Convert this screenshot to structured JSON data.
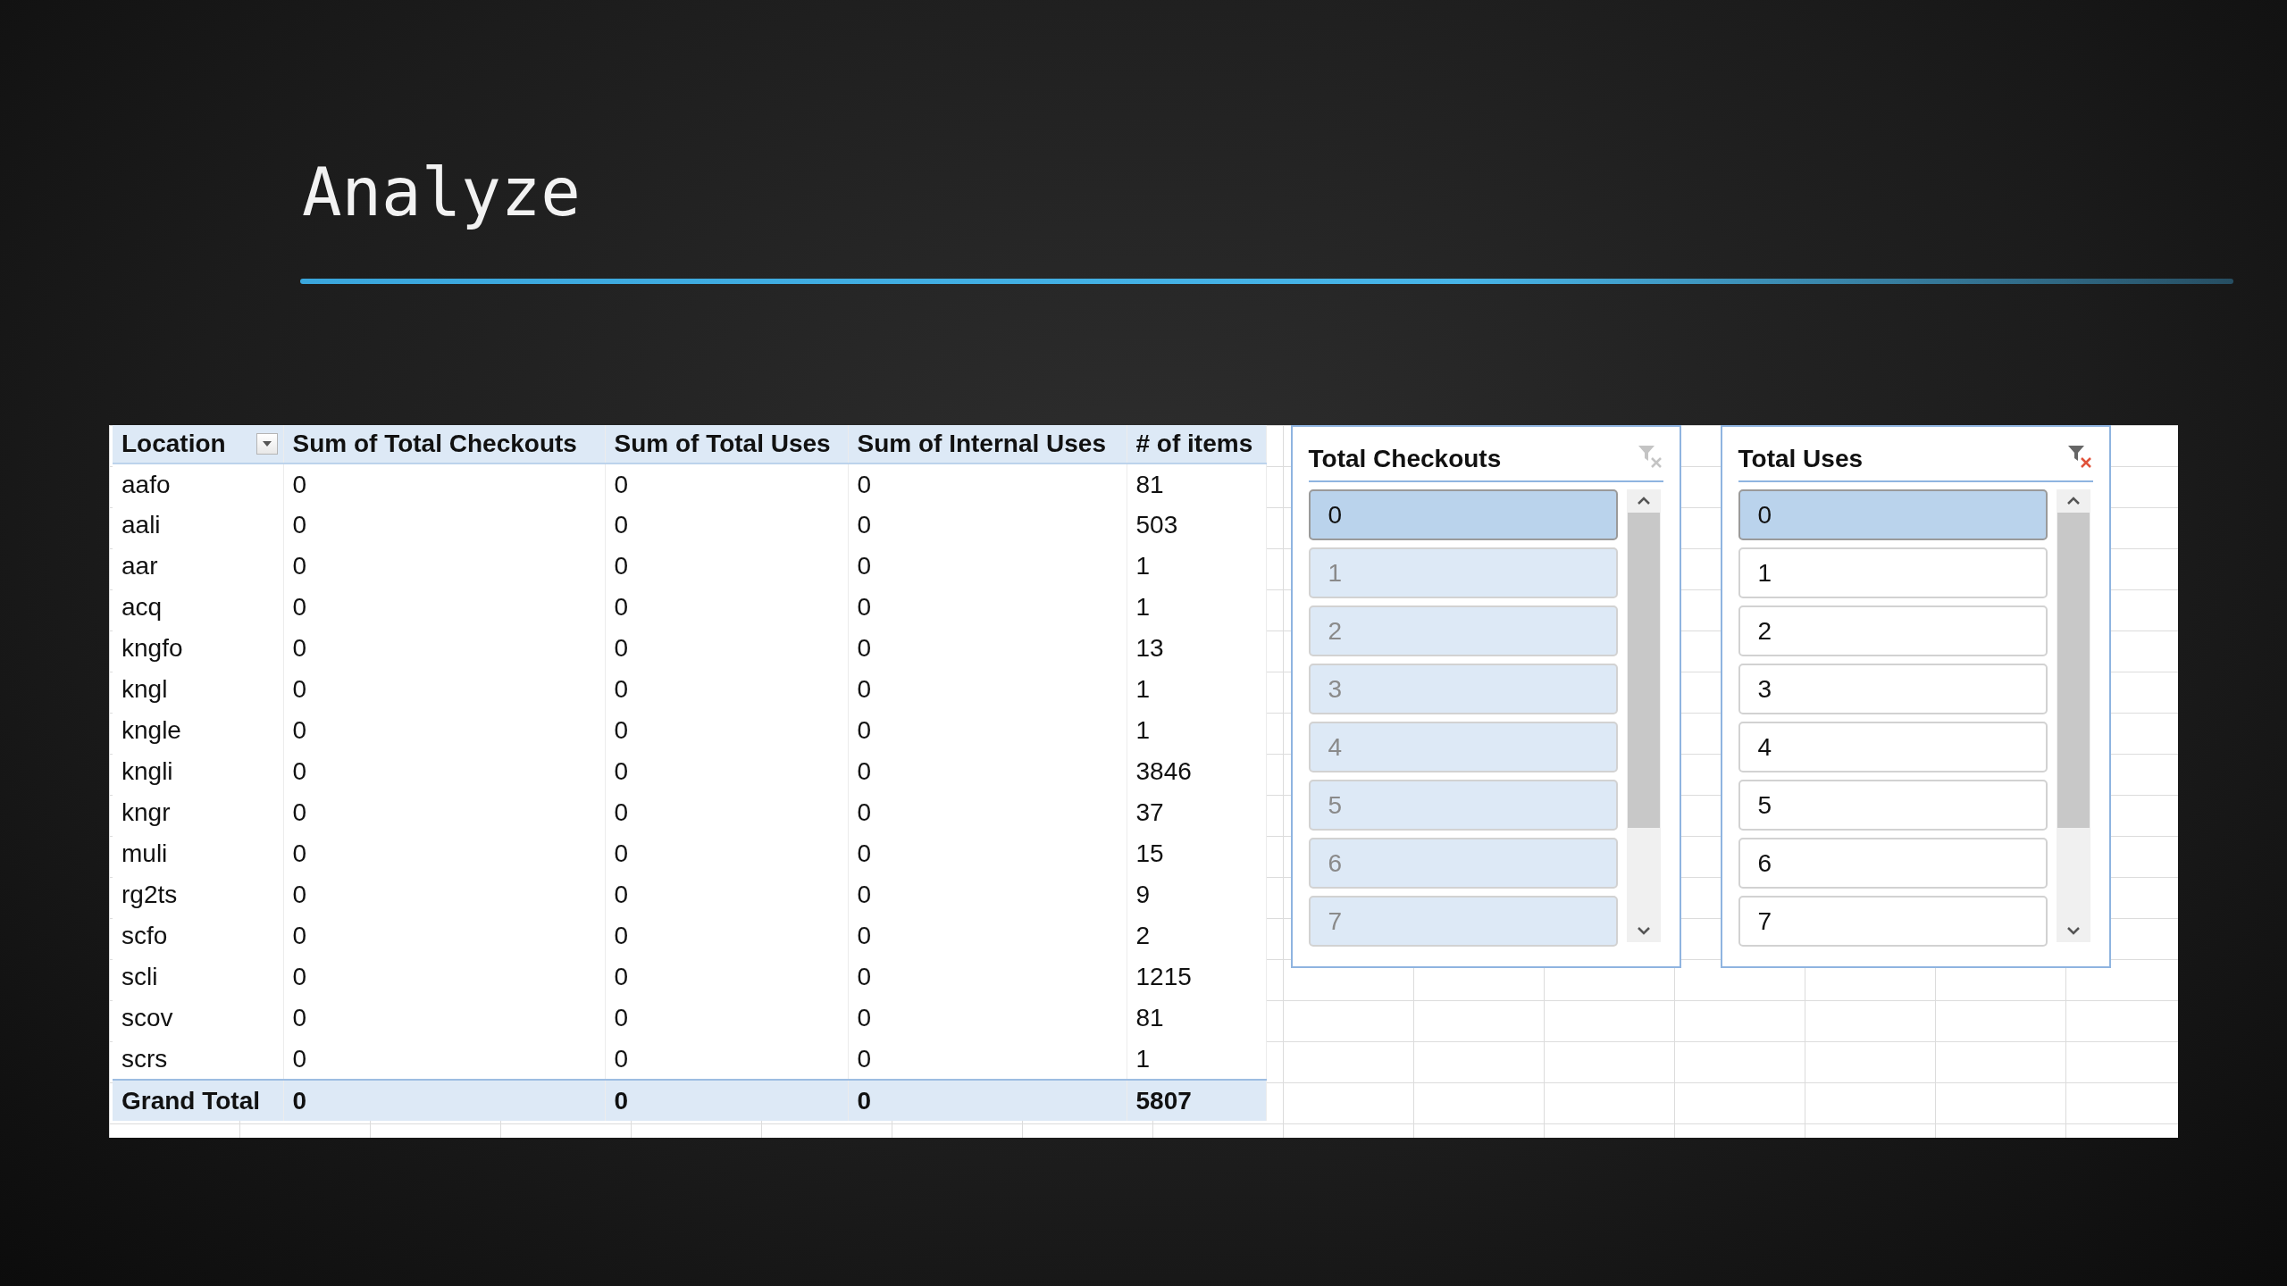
{
  "title": "Analyze",
  "pivot_table": {
    "columns": [
      {
        "label": "Location",
        "dropdown": true
      },
      {
        "label": "Sum of Total Checkouts",
        "dropdown": false
      },
      {
        "label": "Sum of Total Uses",
        "dropdown": false
      },
      {
        "label": "Sum of Internal Uses",
        "dropdown": false
      },
      {
        "label": "# of items",
        "dropdown": false
      }
    ],
    "rows": [
      [
        "aafo",
        "0",
        "0",
        "0",
        "81"
      ],
      [
        "aali",
        "0",
        "0",
        "0",
        "503"
      ],
      [
        "aar",
        "0",
        "0",
        "0",
        "1"
      ],
      [
        "acq",
        "0",
        "0",
        "0",
        "1"
      ],
      [
        "kngfo",
        "0",
        "0",
        "0",
        "13"
      ],
      [
        "kngl",
        "0",
        "0",
        "0",
        "1"
      ],
      [
        "kngle",
        "0",
        "0",
        "0",
        "1"
      ],
      [
        "kngli",
        "0",
        "0",
        "0",
        "3846"
      ],
      [
        "kngr",
        "0",
        "0",
        "0",
        "37"
      ],
      [
        "muli",
        "0",
        "0",
        "0",
        "15"
      ],
      [
        "rg2ts",
        "0",
        "0",
        "0",
        "9"
      ],
      [
        "scfo",
        "0",
        "0",
        "0",
        "2"
      ],
      [
        "scli",
        "0",
        "0",
        "0",
        "1215"
      ],
      [
        "scov",
        "0",
        "0",
        "0",
        "81"
      ],
      [
        "scrs",
        "0",
        "0",
        "0",
        "1"
      ]
    ],
    "grand_total": [
      "Grand Total",
      "0",
      "0",
      "0",
      "5807"
    ]
  },
  "slicers": [
    {
      "title": "Total Checkouts",
      "filter_active": false,
      "items": [
        {
          "label": "0",
          "selected": true,
          "has_data": true
        },
        {
          "label": "1",
          "selected": true,
          "has_data": false
        },
        {
          "label": "2",
          "selected": true,
          "has_data": false
        },
        {
          "label": "3",
          "selected": true,
          "has_data": false
        },
        {
          "label": "4",
          "selected": true,
          "has_data": false
        },
        {
          "label": "5",
          "selected": true,
          "has_data": false
        },
        {
          "label": "6",
          "selected": true,
          "has_data": false
        },
        {
          "label": "7",
          "selected": true,
          "has_data": false
        }
      ]
    },
    {
      "title": "Total Uses",
      "filter_active": true,
      "items": [
        {
          "label": "0",
          "selected": true,
          "has_data": true
        },
        {
          "label": "1",
          "selected": false,
          "has_data": true
        },
        {
          "label": "2",
          "selected": false,
          "has_data": true
        },
        {
          "label": "3",
          "selected": false,
          "has_data": true
        },
        {
          "label": "4",
          "selected": false,
          "has_data": true
        },
        {
          "label": "5",
          "selected": false,
          "has_data": true
        },
        {
          "label": "6",
          "selected": false,
          "has_data": true
        },
        {
          "label": "7",
          "selected": false,
          "has_data": true
        }
      ]
    }
  ]
}
